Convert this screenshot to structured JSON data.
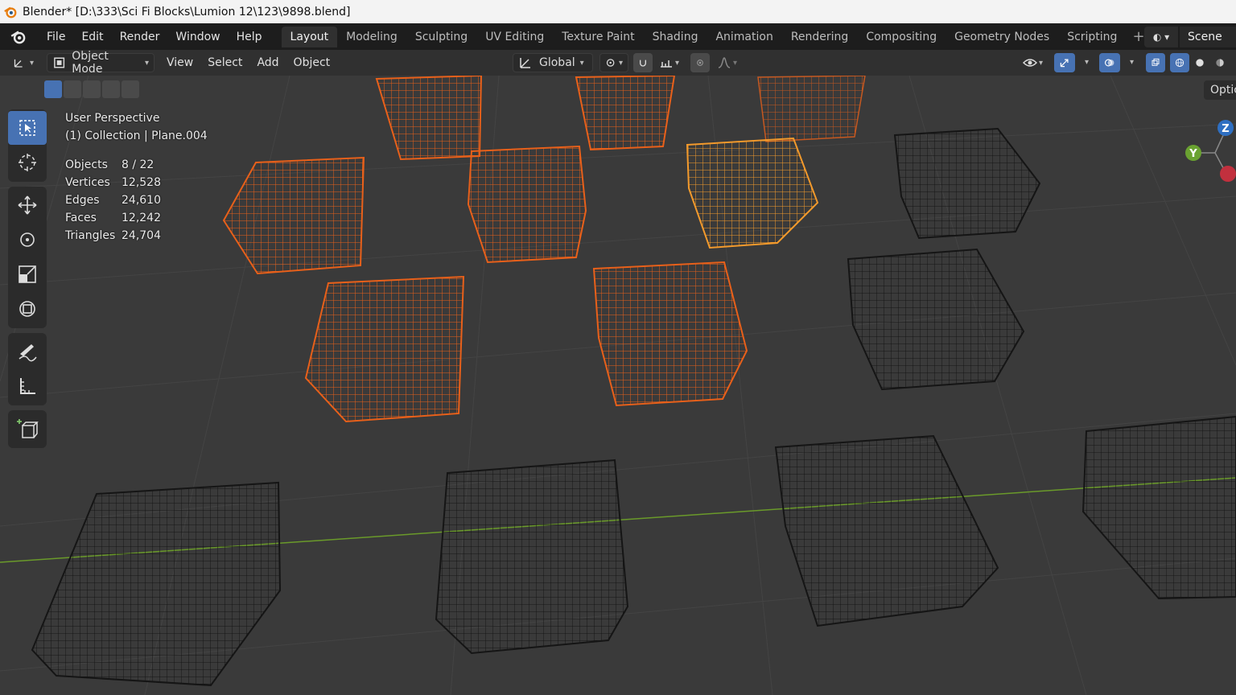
{
  "window": {
    "title": "Blender* [D:\\333\\Sci Fi Blocks\\Lumion 12\\123\\9898.blend]"
  },
  "menu": {
    "items": [
      "File",
      "Edit",
      "Render",
      "Window",
      "Help"
    ]
  },
  "workspaces": {
    "tabs": [
      "Layout",
      "Modeling",
      "Sculpting",
      "UV Editing",
      "Texture Paint",
      "Shading",
      "Animation",
      "Rendering",
      "Compositing",
      "Geometry Nodes",
      "Scripting"
    ],
    "active": "Layout",
    "add_symbol": "+"
  },
  "scene": {
    "name": "Scene"
  },
  "header": {
    "mode": "Object Mode",
    "menus": [
      "View",
      "Select",
      "Add",
      "Object"
    ],
    "transform_orientation": "Global"
  },
  "viewport": {
    "view_name": "User Perspective",
    "context": "(1) Collection | Plane.004",
    "stats": [
      {
        "label": "Objects",
        "value": "8 / 22"
      },
      {
        "label": "Vertices",
        "value": "12,528"
      },
      {
        "label": "Edges",
        "value": "24,610"
      },
      {
        "label": "Faces",
        "value": "12,242"
      },
      {
        "label": "Triangles",
        "value": "24,704"
      }
    ],
    "options_label": "Optic"
  },
  "gizmo": {
    "axes": [
      "Z",
      "Y"
    ]
  },
  "colors": {
    "selected": "#e8601a",
    "active": "#f39a2c",
    "unselected": "#141414",
    "active_ui": "#4772b3"
  }
}
